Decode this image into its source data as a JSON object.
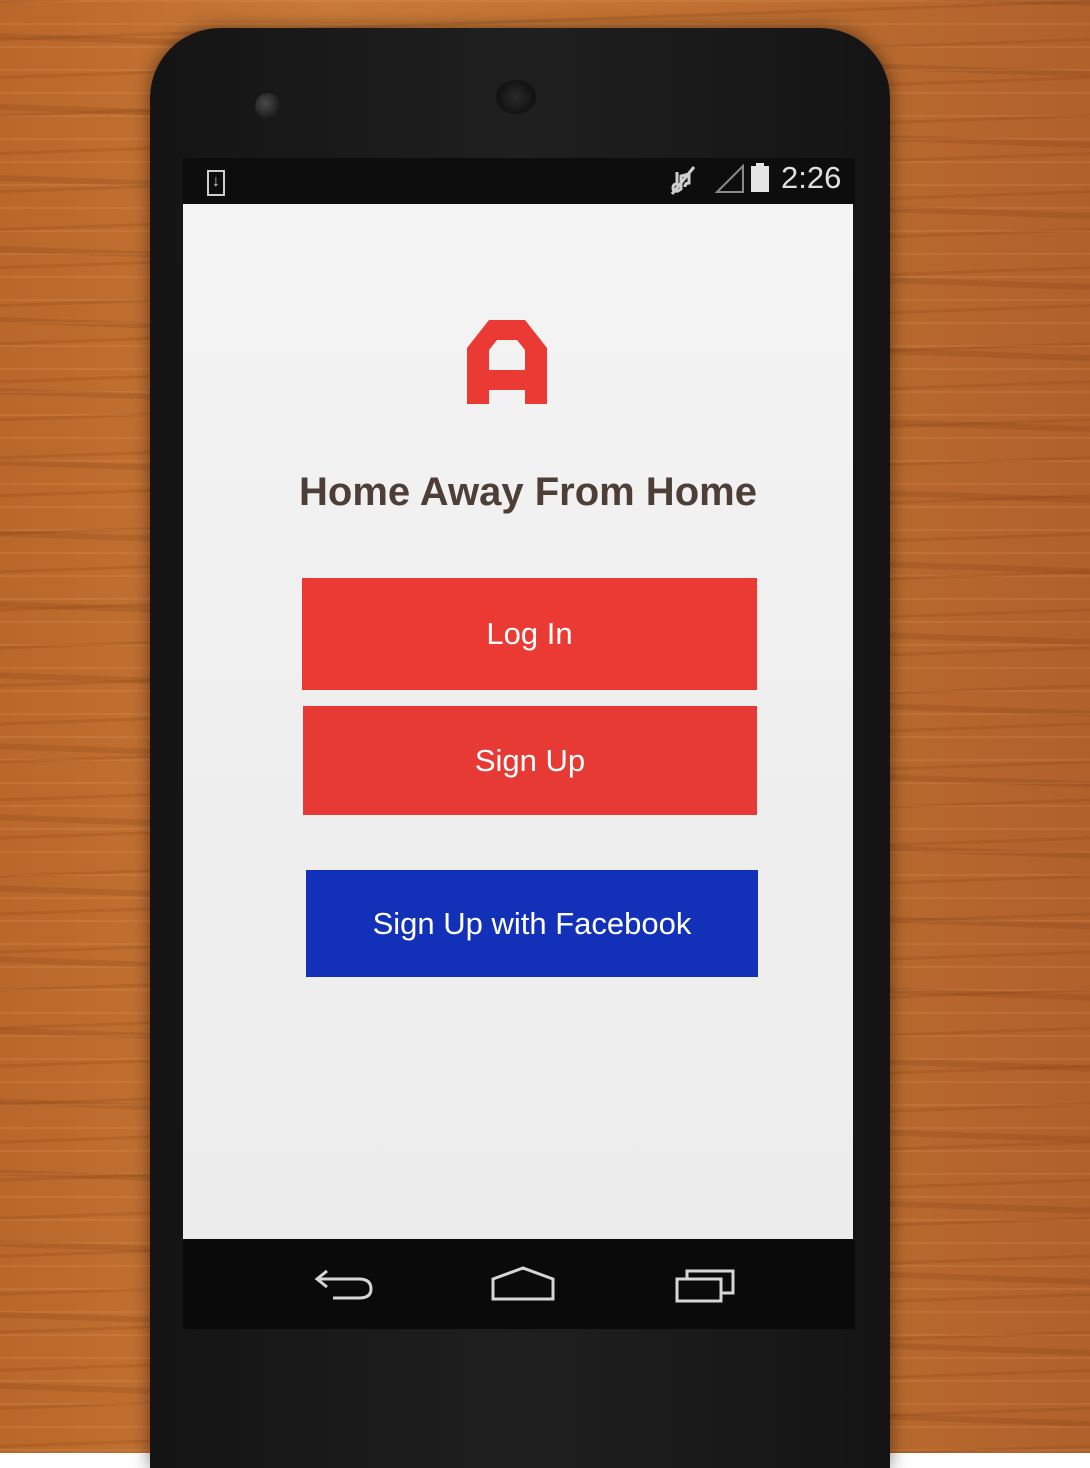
{
  "status_bar": {
    "time": "2:26",
    "icons": [
      "download-notification-icon",
      "mute-icon",
      "signal-icon",
      "battery-icon"
    ]
  },
  "app": {
    "logo_icon": "home-a-logo-icon",
    "title": "Home Away From Home"
  },
  "buttons": {
    "login_label": "Log In",
    "signup_label": "Sign Up",
    "facebook_label": "Sign Up with Facebook"
  },
  "nav_bar": {
    "icons": [
      "back-icon",
      "home-icon",
      "recents-icon"
    ]
  },
  "colors": {
    "primary_red": "#ea3a33",
    "facebook_blue": "#1231b8",
    "title_text": "#4d3f37"
  }
}
